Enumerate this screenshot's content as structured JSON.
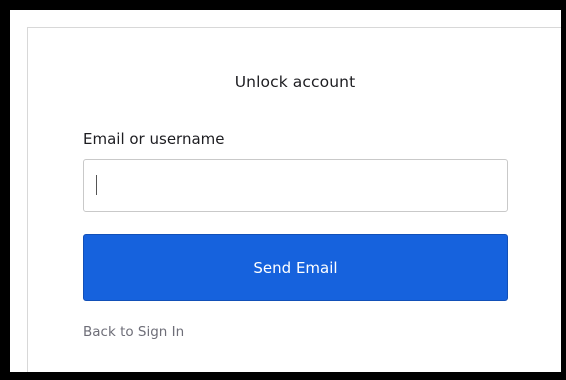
{
  "colors": {
    "background": "#000000",
    "card_background": "#ffffff",
    "primary_button": "#1662dd",
    "text": "#1d1d21",
    "link": "#6e6e78"
  },
  "unlock": {
    "title": "Unlock account",
    "username_label": "Email or username",
    "username_value": "",
    "send_button_label": "Send Email",
    "back_link_label": "Back to Sign In"
  }
}
